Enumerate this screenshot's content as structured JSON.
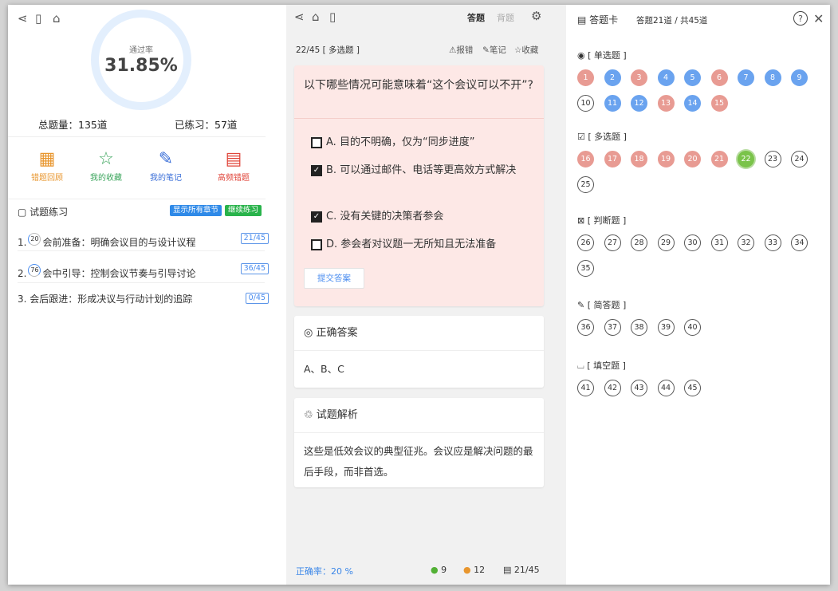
{
  "left": {
    "ring": {
      "label": "通过率",
      "value": "31.85%",
      "progress": 0.3185
    },
    "total_label": "总题量：135道",
    "practiced_label": "已练习：57道",
    "tools": [
      {
        "label": "错题回顾",
        "color": "#e8962e",
        "icon": "calendar-icon"
      },
      {
        "label": "我的收藏",
        "color": "#3ba55c",
        "icon": "star-icon"
      },
      {
        "label": "我的笔记",
        "color": "#3b6fd8",
        "icon": "pen-icon"
      },
      {
        "label": "高频错题",
        "color": "#e0453a",
        "icon": "stack-icon"
      }
    ],
    "section_title": "试题练习",
    "show_all": "显示所有章节",
    "continue": "继续练习",
    "chapters": [
      {
        "num": "1.",
        "progress": "20",
        "title": "会前准备：明确会议目的与设计议程",
        "count": "21/45"
      },
      {
        "num": "2.",
        "progress": "76",
        "title": "会中引导：控制会议节奏与引导讨论",
        "count": "36/45"
      },
      {
        "num": "3.",
        "progress": "",
        "title": "会后跟进：形成决议与行动计划的追踪",
        "count": "0/45"
      }
    ]
  },
  "mid": {
    "mode_answer": "答题",
    "mode_recite": "背题",
    "question_meta": "22/45 [ 多选题 ]",
    "actions": {
      "report": "报错",
      "note": "笔记",
      "favorite": "收藏"
    },
    "question": "以下哪些情况可能意味着“这个会议可以不开”?",
    "options": [
      {
        "letter": "A",
        "sep": ".",
        "text": "目的不明确，仅为“同步进度”",
        "checked": false
      },
      {
        "letter": "B",
        "sep": ".",
        "text": "可以通过邮件、电话等更高效方式解决",
        "checked": true
      },
      {
        "letter": "C",
        "sep": ".",
        "text": "没有关键的决策者参会",
        "checked": true
      },
      {
        "letter": "D",
        "sep": ".",
        "text": "参会者对议题一无所知且无法准备",
        "checked": false
      }
    ],
    "submit": "提交答案",
    "answer_title": "正确答案",
    "answer": "A、B、C",
    "analysis_title": "试题解析",
    "analysis": "这些是低效会议的典型征兆。会议应是解决问题的最后手段，而非首选。",
    "footer": {
      "accuracy": "正确率：20 %",
      "correct": "9",
      "wrong": "12",
      "progress": "21/45"
    }
  },
  "right": {
    "title": "答题卡",
    "summary": "答题21道 / 共45道",
    "groups": [
      {
        "label": "[ 单选题 ]",
        "icon": "radio-icon",
        "items": [
          {
            "n": "1",
            "s": "red"
          },
          {
            "n": "2",
            "s": "blue"
          },
          {
            "n": "3",
            "s": "red"
          },
          {
            "n": "4",
            "s": "blue"
          },
          {
            "n": "5",
            "s": "blue"
          },
          {
            "n": "6",
            "s": "red"
          },
          {
            "n": "7",
            "s": "blue"
          },
          {
            "n": "8",
            "s": "blue"
          },
          {
            "n": "9",
            "s": "blue"
          },
          {
            "n": "10",
            "s": ""
          },
          {
            "n": "11",
            "s": "blue"
          },
          {
            "n": "12",
            "s": "blue"
          },
          {
            "n": "13",
            "s": "red"
          },
          {
            "n": "14",
            "s": "blue"
          },
          {
            "n": "15",
            "s": "red"
          }
        ]
      },
      {
        "label": "[ 多选题 ]",
        "icon": "checkbox-icon",
        "items": [
          {
            "n": "16",
            "s": "red"
          },
          {
            "n": "17",
            "s": "red"
          },
          {
            "n": "18",
            "s": "red"
          },
          {
            "n": "19",
            "s": "red"
          },
          {
            "n": "20",
            "s": "red"
          },
          {
            "n": "21",
            "s": "red"
          },
          {
            "n": "22",
            "s": "green cur"
          },
          {
            "n": "23",
            "s": ""
          },
          {
            "n": "24",
            "s": ""
          },
          {
            "n": "25",
            "s": ""
          }
        ]
      },
      {
        "label": "[ 判断题 ]",
        "icon": "judge-icon",
        "items": [
          {
            "n": "26",
            "s": ""
          },
          {
            "n": "27",
            "s": ""
          },
          {
            "n": "28",
            "s": ""
          },
          {
            "n": "29",
            "s": ""
          },
          {
            "n": "30",
            "s": ""
          },
          {
            "n": "31",
            "s": ""
          },
          {
            "n": "32",
            "s": ""
          },
          {
            "n": "33",
            "s": ""
          },
          {
            "n": "34",
            "s": ""
          },
          {
            "n": "35",
            "s": ""
          }
        ]
      },
      {
        "label": "[ 简答题 ]",
        "icon": "edit-icon",
        "items": [
          {
            "n": "36",
            "s": ""
          },
          {
            "n": "37",
            "s": ""
          },
          {
            "n": "38",
            "s": ""
          },
          {
            "n": "39",
            "s": ""
          },
          {
            "n": "40",
            "s": ""
          }
        ]
      },
      {
        "label": "[ 填空题 ]",
        "icon": "blank-icon",
        "items": [
          {
            "n": "41",
            "s": ""
          },
          {
            "n": "42",
            "s": ""
          },
          {
            "n": "43",
            "s": ""
          },
          {
            "n": "44",
            "s": ""
          },
          {
            "n": "45",
            "s": ""
          }
        ]
      }
    ]
  }
}
